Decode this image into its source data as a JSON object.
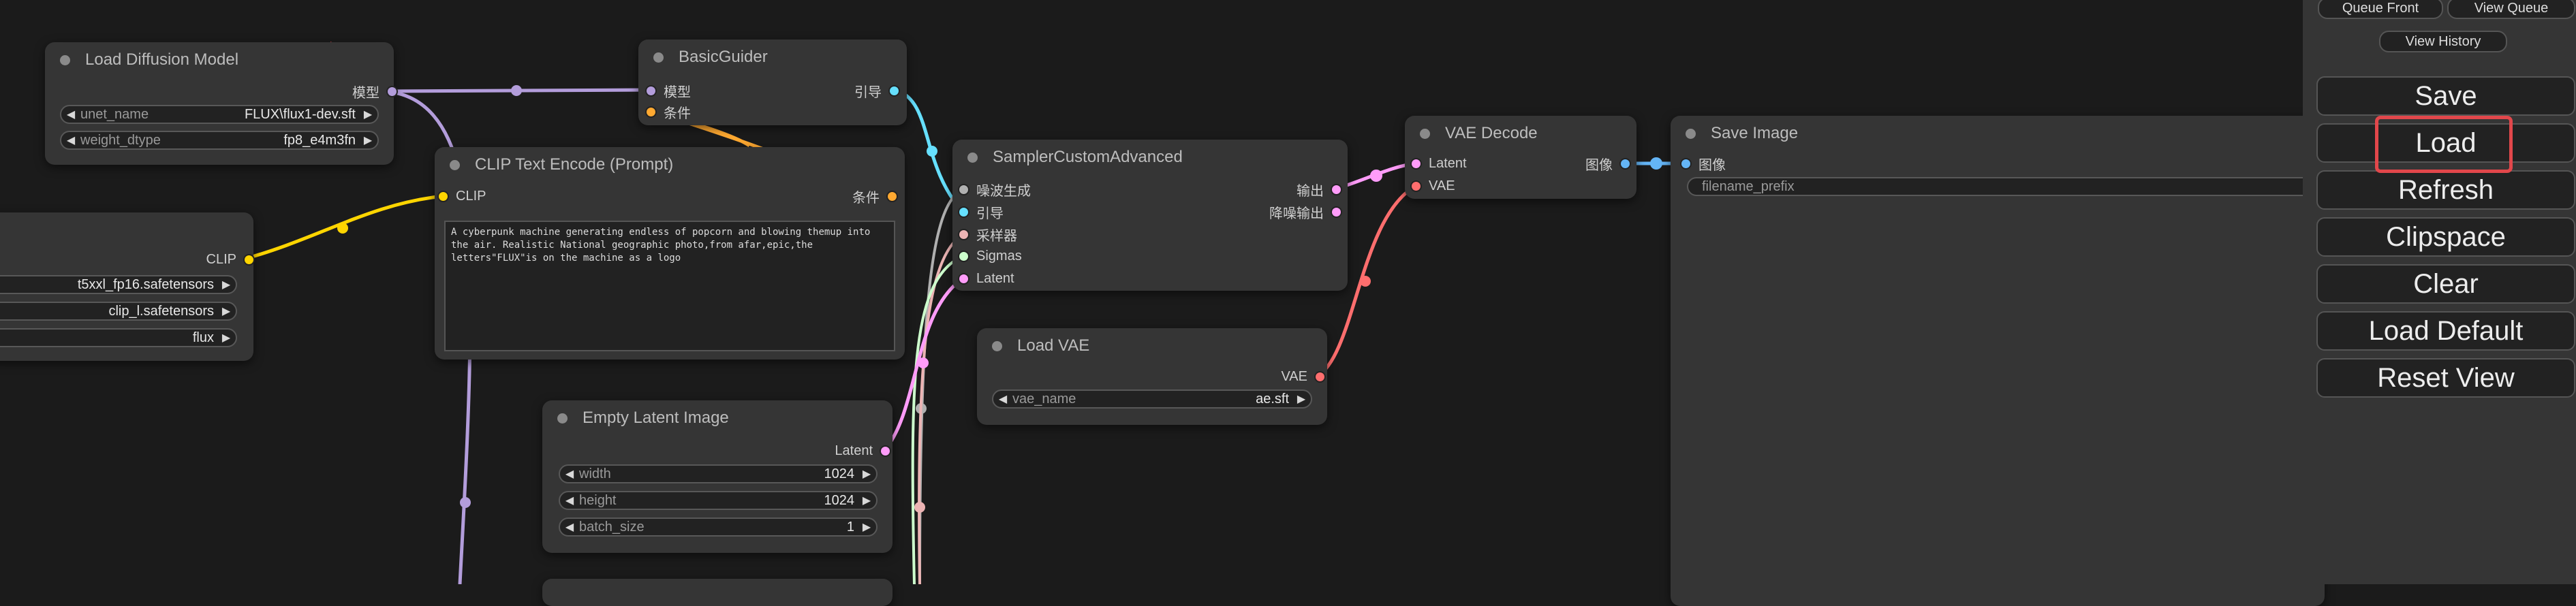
{
  "colors": {
    "clip": "#ffd500",
    "model": "#b39ddb",
    "conditioning": "#ffa931",
    "guider": "#66e0ff",
    "noise": "#b0b0b0",
    "sampler": "#ecb4b4",
    "sigmas": "#cdffcd",
    "latent": "#ff9cf9",
    "vae": "#ff6e6e",
    "image": "#64b5f6",
    "highlight": "#e2474b"
  },
  "nodes": {
    "load_diffusion_model": {
      "title": "Load Diffusion Model",
      "output": "模型",
      "widgets": [
        {
          "name": "unet_name",
          "value": "FLUX\\flux1-dev.sft"
        },
        {
          "name": "weight_dtype",
          "value": "fp8_e4m3fn"
        }
      ]
    },
    "dual_clip_loader": {
      "output": "CLIP",
      "widgets": [
        {
          "value": "t5xxl_fp16.safetensors"
        },
        {
          "value": "clip_l.safetensors"
        },
        {
          "value": "flux"
        }
      ]
    },
    "basic_guider": {
      "title": "BasicGuider",
      "inputs": [
        "模型",
        "条件"
      ],
      "output": "引导"
    },
    "clip_text_encode": {
      "title": "CLIP Text Encode (Prompt)",
      "input": "CLIP",
      "output": "条件",
      "text": "A cyberpunk machine generating endless of popcorn and blowing themup into the air. Realistic National geographic photo,from afar,epic,the letters\"FLUX\"is on the machine as a logo"
    },
    "sampler_custom_advanced": {
      "title": "SamplerCustomAdvanced",
      "inputs": [
        "噪波生成",
        "引导",
        "采样器",
        "Sigmas",
        "Latent"
      ],
      "outputs": [
        "输出",
        "降噪输出"
      ]
    },
    "load_vae": {
      "title": "Load VAE",
      "output": "VAE",
      "widgets": [
        {
          "name": "vae_name",
          "value": "ae.sft"
        }
      ]
    },
    "empty_latent_image": {
      "title": "Empty Latent Image",
      "output": "Latent",
      "widgets": [
        {
          "name": "width",
          "value": "1024"
        },
        {
          "name": "height",
          "value": "1024"
        },
        {
          "name": "batch_size",
          "value": "1"
        }
      ]
    },
    "vae_decode": {
      "title": "VAE Decode",
      "inputs": [
        "Latent",
        "VAE"
      ],
      "output": "图像"
    },
    "save_image": {
      "title": "Save Image",
      "input": "图像",
      "widget_placeholder": "filename_prefix"
    }
  },
  "panel": {
    "queue_front": "Queue Front",
    "view_queue": "View Queue",
    "view_history": "View History",
    "save": "Save",
    "load": "Load",
    "refresh": "Refresh",
    "clipspace": "Clipspace",
    "clear": "Clear",
    "load_default": "Load Default",
    "reset_view": "Reset View"
  }
}
